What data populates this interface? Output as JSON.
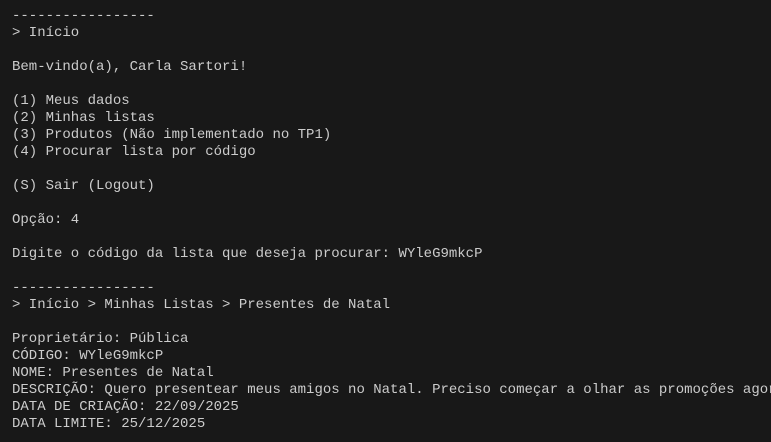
{
  "terminal": {
    "lines": [
      "-----------------",
      "> Início",
      "",
      "Bem-vindo(a), Carla Sartori!",
      "",
      "(1) Meus dados",
      "(2) Minhas listas",
      "(3) Produtos (Não implementado no TP1)",
      "(4) Procurar lista por código",
      "",
      "(S) Sair (Logout)",
      "",
      "Opção: 4",
      "",
      "Digite o código da lista que deseja procurar: WYleG9mkcP",
      "",
      "-----------------",
      "> Início > Minhas Listas > Presentes de Natal",
      "",
      "Proprietário: Pública",
      "CÓDIGO: WYleG9mkcP",
      "NOME: Presentes de Natal",
      "DESCRIÇÃO: Quero presentear meus amigos no Natal. Preciso começar a olhar as promoções agora.",
      "DATA DE CRIAÇÃO: 22/09/2025",
      "DATA LIMITE: 25/12/2025"
    ],
    "colors": {
      "background": "#181818",
      "text": "#cccccc"
    }
  }
}
